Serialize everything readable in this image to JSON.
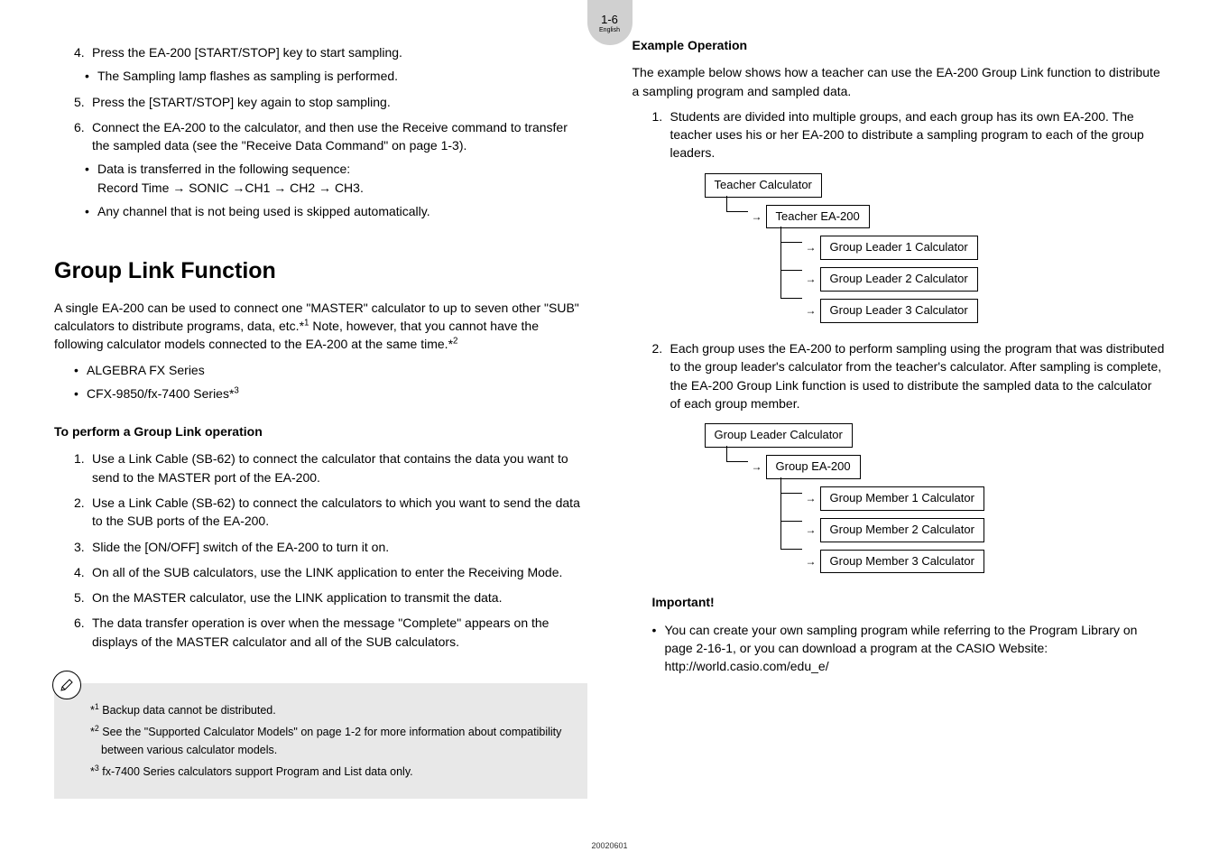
{
  "page": {
    "number": "1-6",
    "lang": "English",
    "footer": "20020601"
  },
  "left": {
    "items": [
      {
        "n": "4.",
        "t": "Press the EA-200 [START/STOP] key to start sampling."
      },
      {
        "bullet": "•",
        "t": "The Sampling lamp flashes as sampling is performed."
      },
      {
        "n": "5.",
        "t": "Press the [START/STOP] key again to stop sampling."
      },
      {
        "n": "6.",
        "t": "Connect the EA-200 to the calculator, and then use the Receive command to transfer the sampled data (see the \"Receive Data Command\" on page 1-3)."
      },
      {
        "bullet": "•",
        "t": "Data is transferred in the following sequence:"
      },
      {
        "sub": "Record Time → SONIC →CH1 → CH2 → CH3."
      },
      {
        "bullet": "•",
        "t": "Any channel that is not being used is skipped automatically."
      }
    ],
    "h1": "Group Link Function",
    "intro": "A single EA-200 can be used to connect one \"MASTER\" calculator to up to seven other \"SUB\" calculators to distribute programs, data, etc.*",
    "intro_sup1": "1",
    "intro2": " Note, however, that you cannot have the following calculator models connected to the EA-200 at the same time.*",
    "intro_sup2": "2",
    "models": [
      "ALGEBRA FX Series",
      "CFX-9850/fx-7400 Series*"
    ],
    "models_sup": "3",
    "sub1": "To perform a Group Link operation",
    "steps": [
      {
        "n": "1.",
        "t": "Use a Link Cable (SB-62) to connect the calculator that contains the data you want to send to the MASTER port of the EA-200."
      },
      {
        "n": "2.",
        "t": "Use a Link Cable (SB-62) to connect the calculators to which you want to send the data to the SUB ports of the EA-200."
      },
      {
        "n": "3.",
        "t": "Slide the [ON/OFF] switch of the EA-200 to turn it on."
      },
      {
        "n": "4.",
        "t": "On all of the SUB calculators, use the LINK application to enter the Receiving Mode."
      },
      {
        "n": "5.",
        "t": "On the MASTER calculator, use the LINK application to transmit the data."
      },
      {
        "n": "6.",
        "t": "The data transfer operation is over when the message \"Complete\" appears on the displays of the MASTER calculator and all of the SUB calculators."
      }
    ],
    "notes": [
      {
        "s": "1",
        "t": "Backup data cannot be distributed."
      },
      {
        "s": "2",
        "t": "See the \"Supported Calculator Models\" on page 1-2 for more information about compatibility between various calculator models."
      },
      {
        "s": "3",
        "t": "fx-7400 Series calculators support Program and List data only."
      }
    ]
  },
  "right": {
    "h": "Example Operation",
    "intro": "The example below shows how a teacher can use the EA-200 Group Link function to distribute a sampling program and sampled data.",
    "step1n": "1.",
    "step1": "Students are divided into multiple groups, and each group has its own EA-200. The teacher uses his or her EA-200 to distribute a sampling program to each of the group leaders.",
    "diagram1": {
      "root": "Teacher Calculator",
      "l1": "Teacher EA-200",
      "l2a": "Group Leader 1 Calculator",
      "l2b": "Group Leader 2 Calculator",
      "l2c": "Group Leader 3 Calculator"
    },
    "step2n": "2.",
    "step2": "Each group uses the EA-200 to perform sampling using the program that was distributed to the group leader's calculator from the teacher's calculator. After sampling is complete, the EA-200 Group Link function is used to distribute the sampled data to the calculator of each group member.",
    "diagram2": {
      "root": "Group Leader Calculator",
      "l1": "Group EA-200",
      "l2a": "Group Member 1 Calculator",
      "l2b": "Group Member 2 Calculator",
      "l2c": "Group Member 3 Calculator"
    },
    "important_h": "Important!",
    "important_bullet": "•",
    "important": "You can create your own sampling program while referring to the Program Library on page 2-16-1, or you can download a program at the CASIO Website: http://world.casio.com/edu_e/"
  }
}
